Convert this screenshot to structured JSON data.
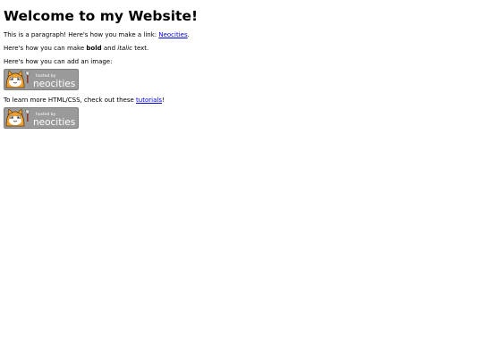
{
  "heading": "Welcome to my Website!",
  "paragraph1": {
    "before": "This is a paragraph! Here's how you make a link: ",
    "link_text": "Neocities",
    "after": "."
  },
  "paragraph2": {
    "before": "Here's how you can make ",
    "bold": "bold",
    "middle": " and ",
    "italic": "italic",
    "after": " text."
  },
  "paragraph3": "Here's how you can add an image:",
  "paragraph4": {
    "before": "To learn more HTML/CSS, check out these ",
    "link_text": "tutorials",
    "after": "!"
  },
  "badge": {
    "line1": "hosted by",
    "line2": "neocities",
    "colors": {
      "background": "#9a9a9a",
      "text": "#ffffff",
      "cat_fur": "#f0a030"
    }
  },
  "colors": {
    "link": "#0000ee",
    "text": "#000000",
    "background": "#ffffff"
  }
}
